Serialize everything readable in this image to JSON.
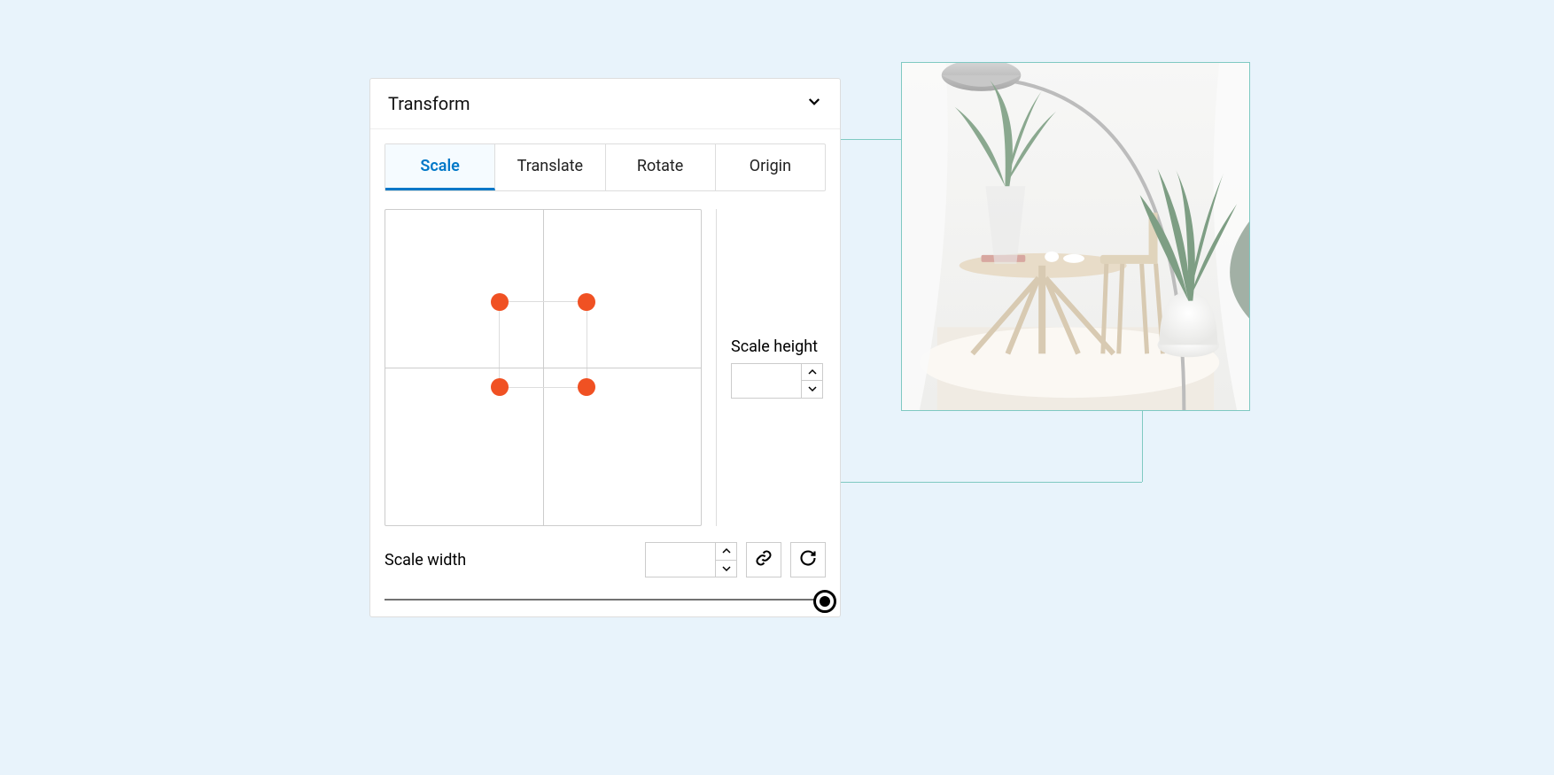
{
  "panel": {
    "title": "Transform",
    "tabs": [
      "Scale",
      "Translate",
      "Rotate",
      "Origin"
    ],
    "active_tab": 0
  },
  "scale": {
    "height_label": "Scale height",
    "height_value": "",
    "width_label": "Scale width",
    "width_value": ""
  },
  "icons": {
    "chevron": "chevron-down",
    "link": "link",
    "reset": "rotate-clockwise"
  }
}
